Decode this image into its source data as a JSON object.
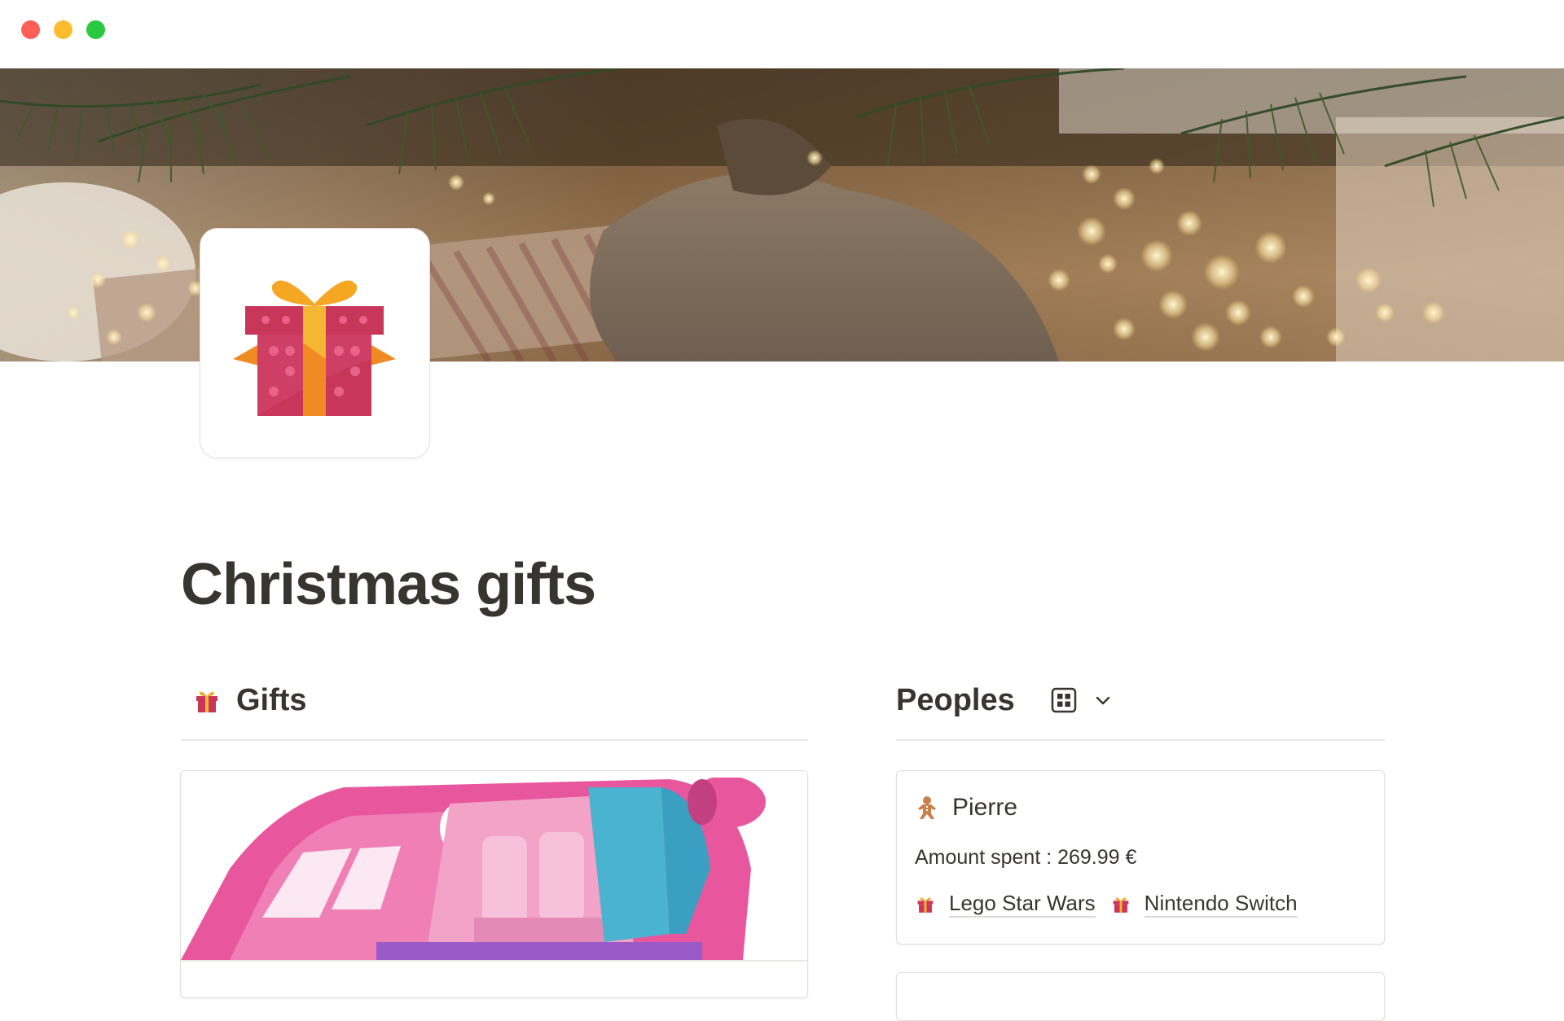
{
  "window": {
    "controls": [
      "close",
      "minimize",
      "zoom"
    ]
  },
  "cover": {
    "description_icon": "christmas-tree-cover-image"
  },
  "page": {
    "icon": "gift-icon",
    "title": "Christmas gifts"
  },
  "gifts_section": {
    "icon": "gift-icon",
    "title": "Gifts",
    "cards": [
      {
        "image": "pink-toy-airplane-image"
      }
    ]
  },
  "peoples_section": {
    "title": "Peoples",
    "view_icon": "gallery-view-icon",
    "dropdown_icon": "chevron-down-icon",
    "cards": [
      {
        "icon": "gingerbread-man-icon",
        "name": "Pierre",
        "amount_spent": "Amount spent : 269.99 €",
        "gifts": [
          {
            "icon": "gift-icon",
            "label": "Lego Star Wars"
          },
          {
            "icon": "gift-icon",
            "label": "Nintendo Switch"
          }
        ]
      }
    ]
  },
  "colors": {
    "text": "#37352f",
    "divider": "#e9e9e7",
    "close": "#ff5f57",
    "minimize": "#febc2e",
    "zoom": "#28c840"
  }
}
